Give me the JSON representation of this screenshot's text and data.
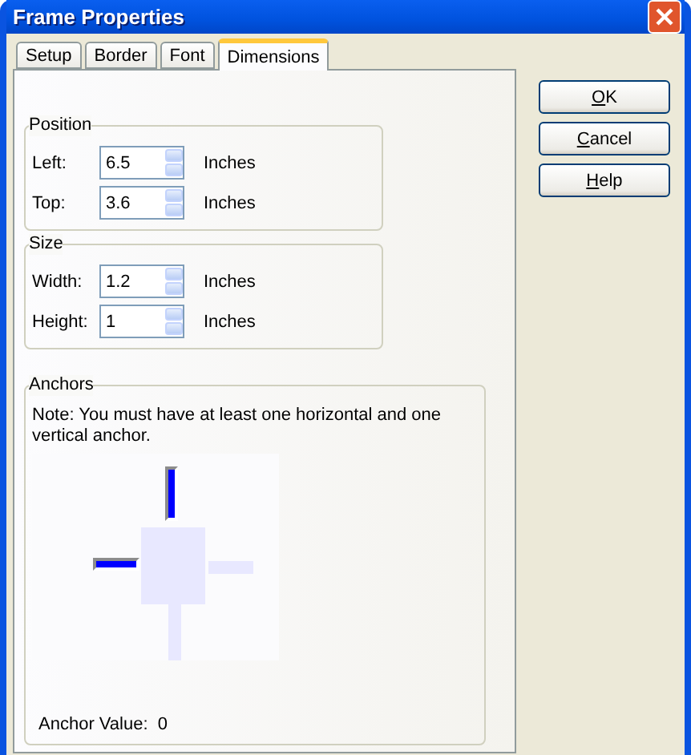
{
  "window": {
    "title": "Frame Properties"
  },
  "tabs": [
    {
      "label": "Setup",
      "selected": false
    },
    {
      "label": "Border",
      "selected": false
    },
    {
      "label": "Font",
      "selected": false
    },
    {
      "label": "Dimensions",
      "selected": true
    }
  ],
  "buttons": [
    {
      "label": "OK"
    },
    {
      "label": "Cancel"
    },
    {
      "label": "Help"
    }
  ],
  "groups": [
    {
      "title": "Position",
      "fields": [
        {
          "label": "Left:",
          "value": "6.5",
          "unit": "Inches"
        },
        {
          "label": "Top:",
          "value": "3.6",
          "unit": "Inches"
        }
      ]
    },
    {
      "title": "Size",
      "fields": [
        {
          "label": "Width:",
          "value": "1.2",
          "unit": "Inches"
        },
        {
          "label": "Height:",
          "value": "1",
          "unit": "Inches"
        }
      ]
    }
  ],
  "anchors": {
    "title": "Anchors",
    "note": "Note: You must have at least one horizontal and one vertical anchor.",
    "items": [
      {
        "kind": "top",
        "on": true
      },
      {
        "kind": "left",
        "on": true
      },
      {
        "kind": "right",
        "on": false
      },
      {
        "kind": "bottom",
        "on": false
      }
    ],
    "value_label": "Anchor Value:",
    "value": "0"
  }
}
